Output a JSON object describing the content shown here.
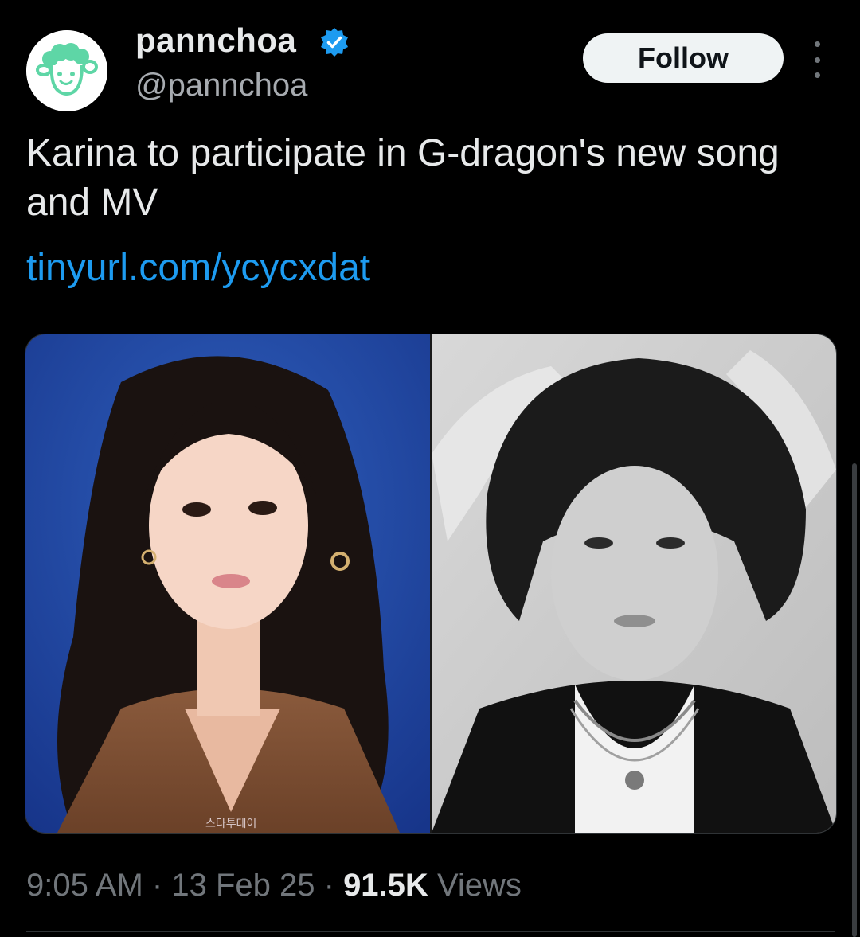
{
  "colors": {
    "background": "#000000",
    "primary_text": "#e7e9ea",
    "secondary_text": "#71767b",
    "link": "#1d9bf0",
    "verified_badge": "#1d9bf0",
    "avatar_accent": "#5ed6a6",
    "follow_button_bg": "#eff3f4"
  },
  "author": {
    "display_name": "pannchoa",
    "handle": "@pannchoa",
    "verified_icon": "verified-badge-icon",
    "avatar_icon": "sheep-mascot-icon"
  },
  "actions": {
    "follow_label": "Follow",
    "more_icon": "more-vertical-icon"
  },
  "tweet": {
    "text": "Karina to participate in G-dragon's new song and MV",
    "link_text": "tinyurl.com/ycycxdat"
  },
  "media": {
    "watermark": "스타투데이"
  },
  "meta": {
    "time": "9:05 AM",
    "separator": "·",
    "date": "13 Feb 25",
    "views_count": "91.5K",
    "views_label": "Views"
  }
}
